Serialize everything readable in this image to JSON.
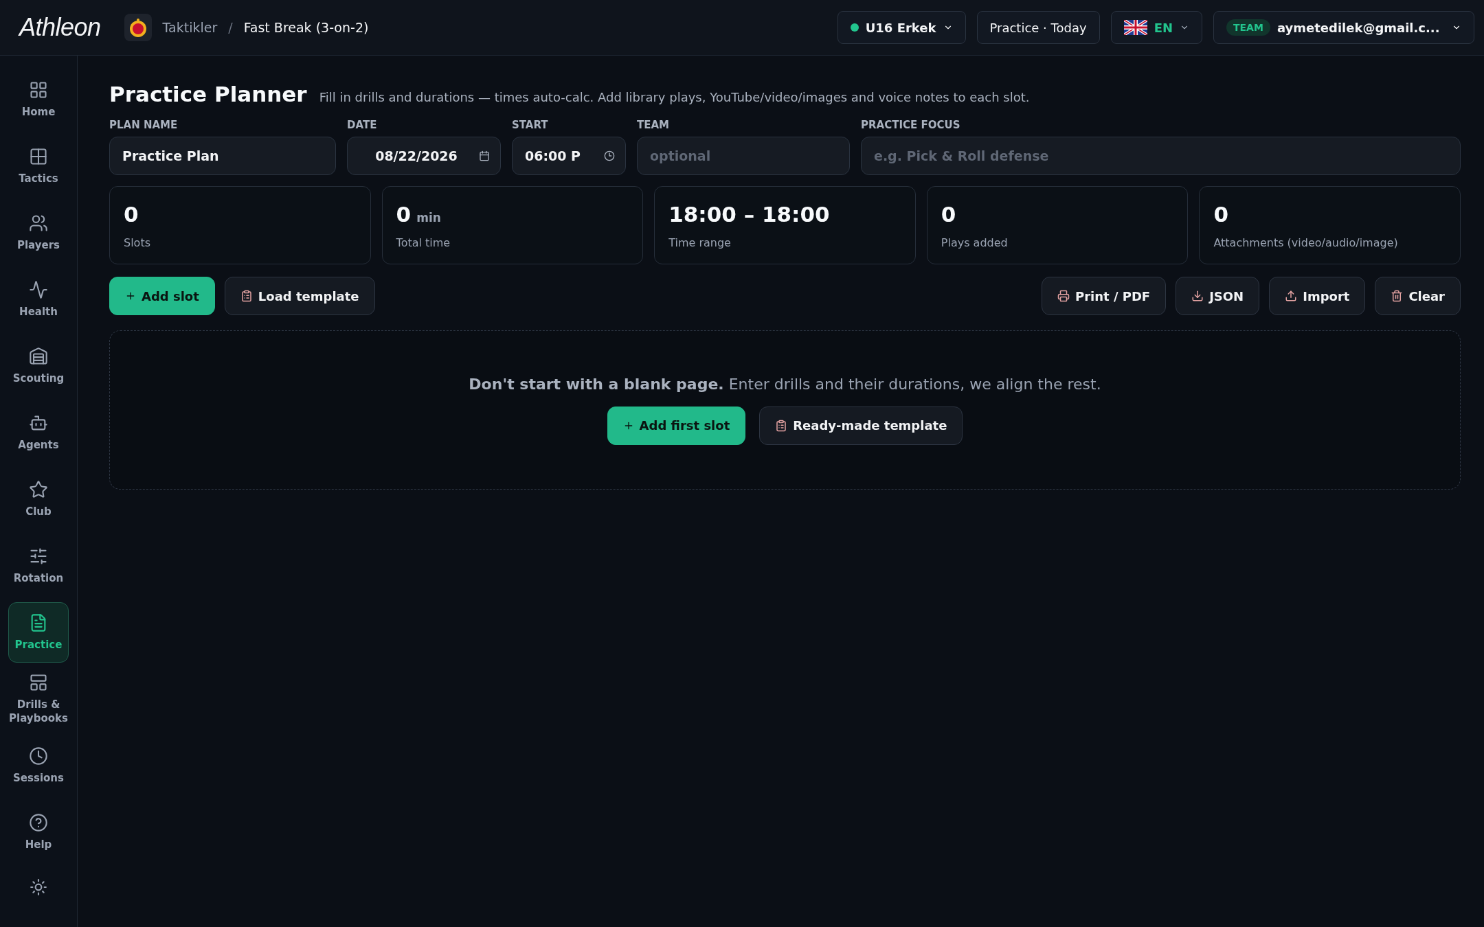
{
  "topbar": {
    "brand": "Athleon",
    "breadcrumb": [
      "Taktikler",
      "/",
      "Fast Break (3-on-2)"
    ],
    "team_select": {
      "label": "U16 Erkek"
    },
    "session_button": "Practice · Today",
    "language": "EN",
    "account": {
      "badge": "TEAM",
      "email": "aymetedilek@gmail.c..."
    }
  },
  "sidebar": {
    "items": [
      {
        "label": "Home",
        "selected": false
      },
      {
        "label": "Tactics",
        "selected": false
      },
      {
        "label": "Players",
        "selected": false
      },
      {
        "label": "Health",
        "selected": false
      },
      {
        "label": "Scouting",
        "selected": false
      },
      {
        "label": "Agents",
        "selected": false
      },
      {
        "label": "Club",
        "selected": false
      },
      {
        "label": "Rotation",
        "selected": false
      },
      {
        "label": "Practice",
        "selected": true
      },
      {
        "label": "Drills & Playbooks",
        "selected": false
      },
      {
        "label": "Sessions",
        "selected": false
      },
      {
        "label": "Help",
        "selected": false
      }
    ]
  },
  "page": {
    "title": "Practice Planner",
    "subtitle": "Fill in drills and durations — times auto-calc. Add library plays, YouTube/video/images and voice notes to each slot."
  },
  "form": [
    {
      "label": "PLAN NAME",
      "value": "Practice Plan",
      "kind": "text"
    },
    {
      "label": "DATE",
      "value": "08/22/2026",
      "kind": "date"
    },
    {
      "label": "START",
      "value": "06:00 P",
      "kind": "time"
    },
    {
      "label": "TEAM",
      "placeholder": "optional",
      "kind": "text"
    },
    {
      "label": "PRACTICE FOCUS",
      "placeholder": "e.g. Pick & Roll defense",
      "kind": "text"
    }
  ],
  "stats": [
    {
      "value": "0",
      "label": "Slots"
    },
    {
      "value": "0",
      "unit": "min",
      "label": "Total time"
    },
    {
      "value": "18:00 – 18:00",
      "label": "Time range"
    },
    {
      "value": "0",
      "label": "Plays added"
    },
    {
      "value": "0",
      "label": "Attachments (video/audio/image)"
    }
  ],
  "actions_left": [
    {
      "label": "Add slot",
      "kind": "primary"
    },
    {
      "label": "Load template",
      "kind": "secondary"
    }
  ],
  "actions_right": [
    {
      "label": "Print / PDF"
    },
    {
      "label": "JSON"
    },
    {
      "label": "Import"
    },
    {
      "label": "Clear"
    }
  ],
  "empty_state": {
    "message": "**Don't start with a blank page.** Enter drills and their durations, we align the rest.",
    "buttons": [
      {
        "label": "Add first slot",
        "kind": "primary"
      },
      {
        "label": "Ready-made template",
        "kind": "secondary"
      }
    ]
  }
}
